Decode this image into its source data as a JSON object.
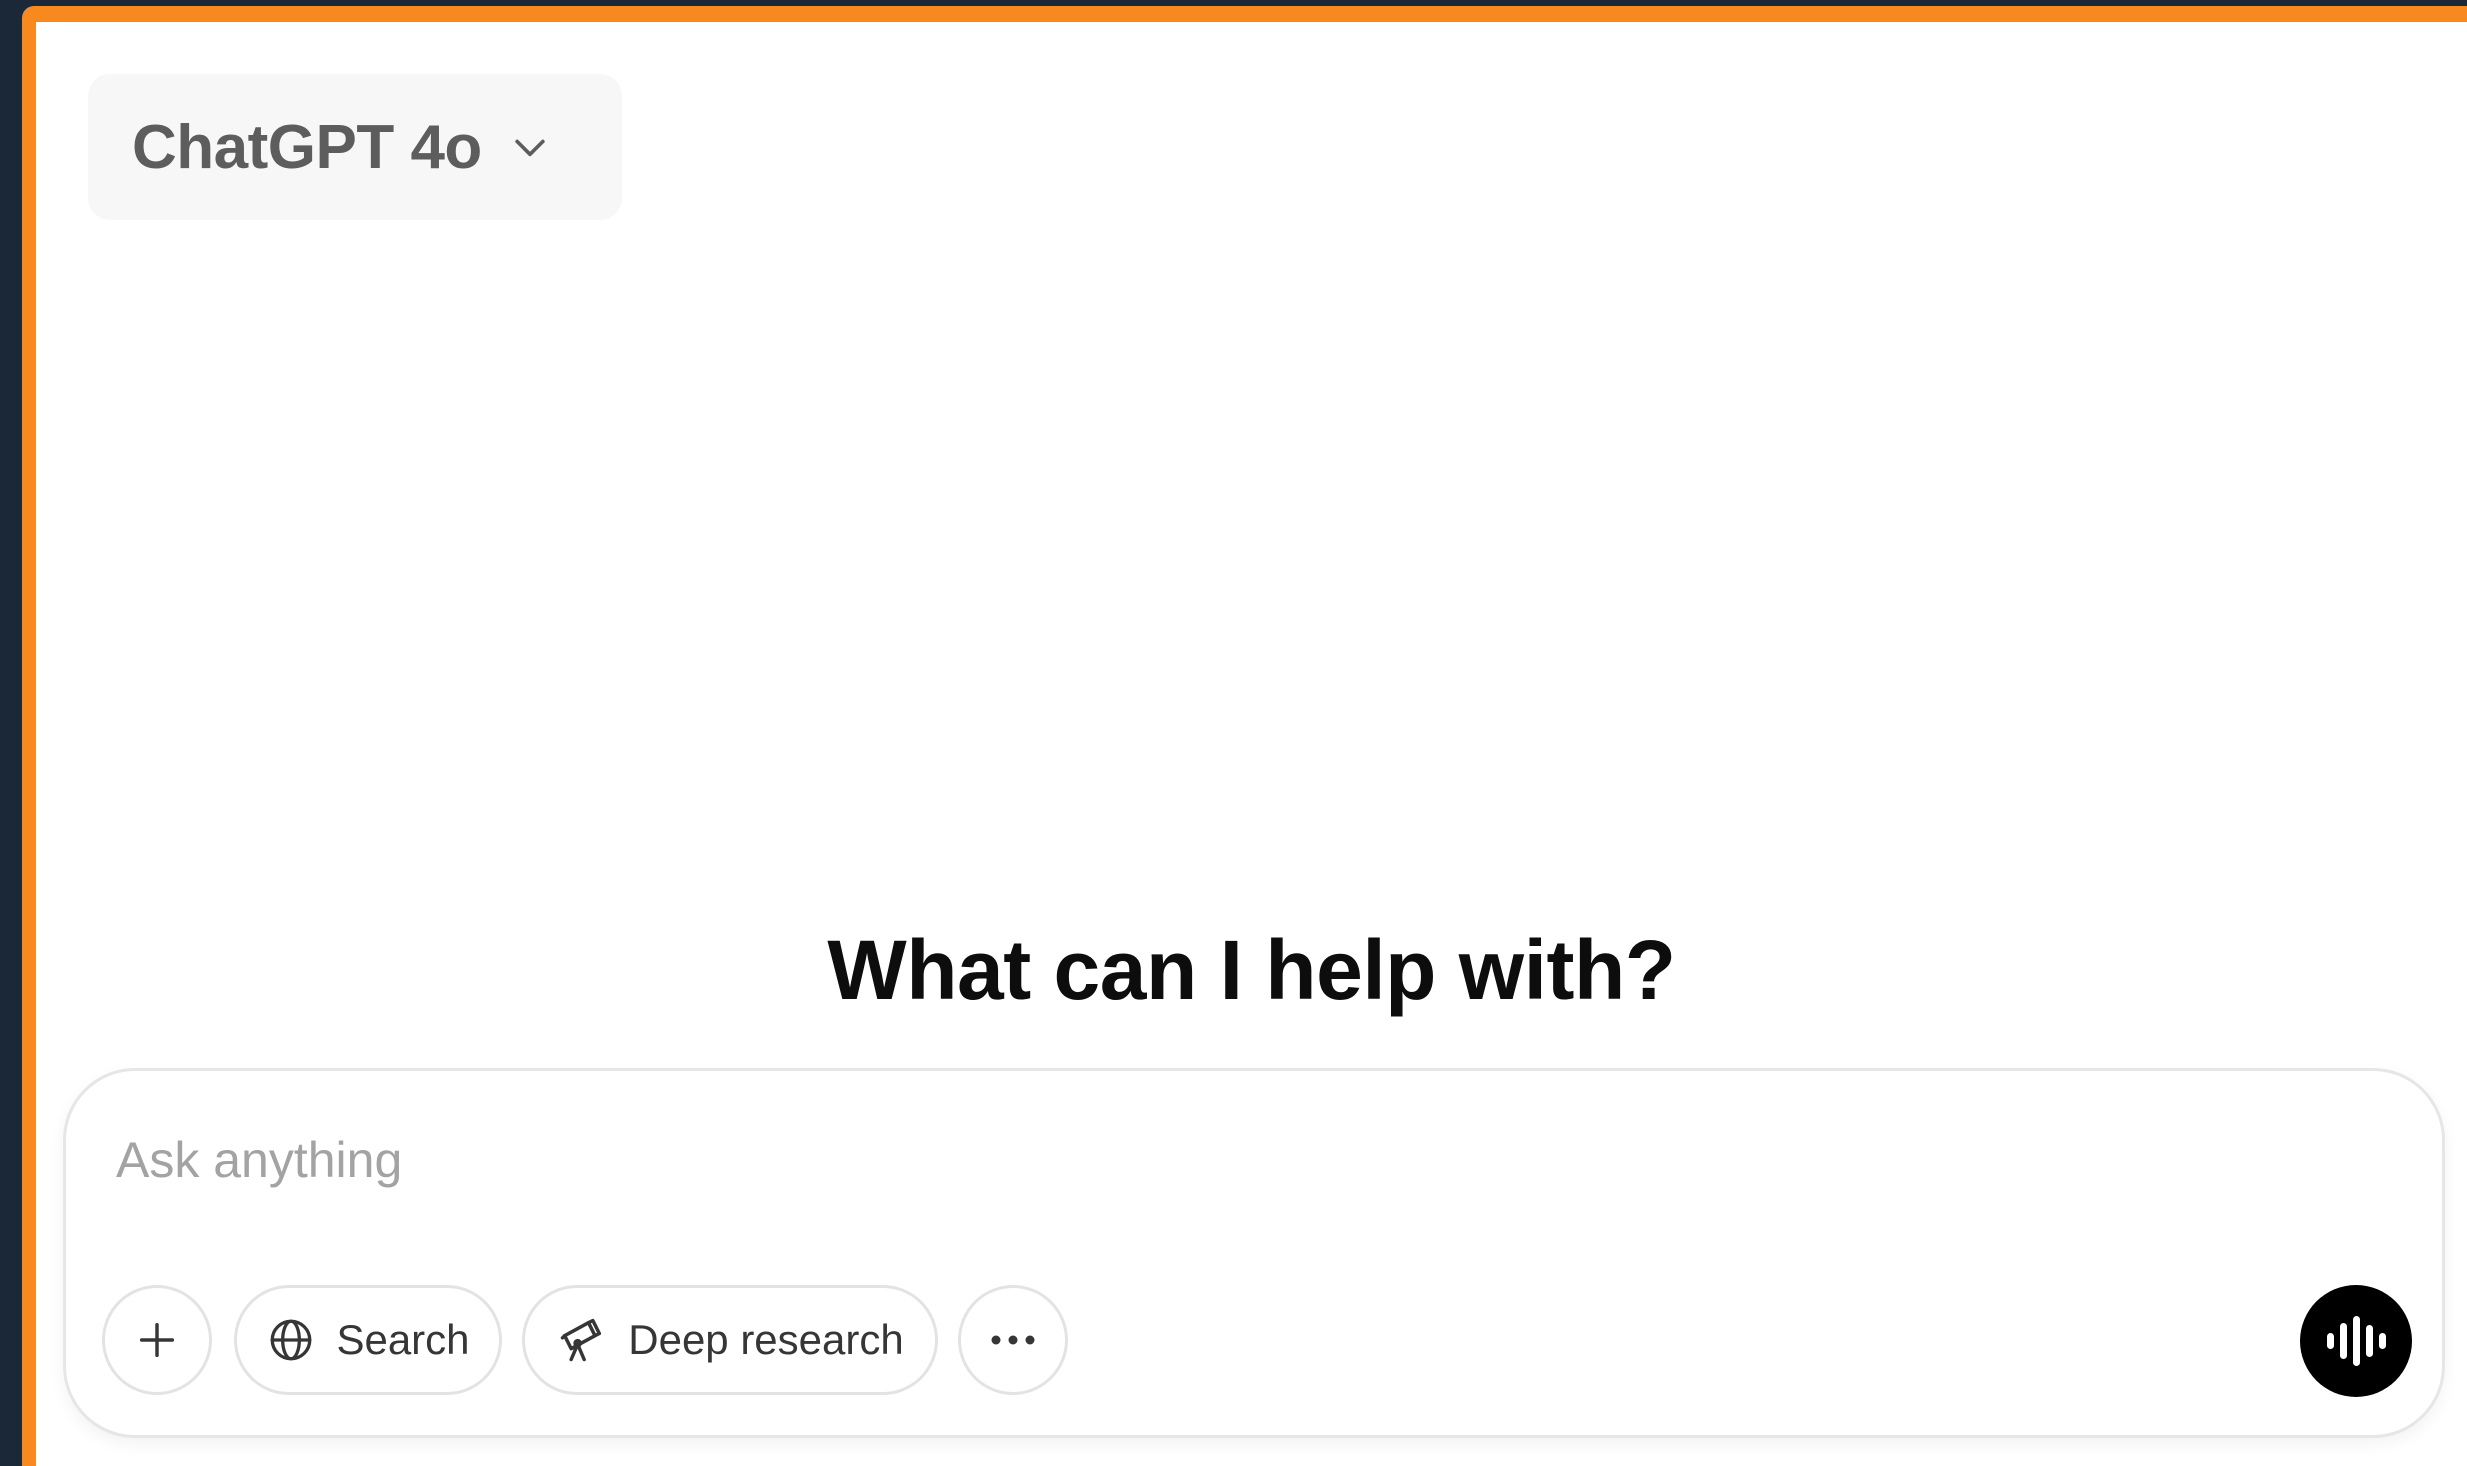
{
  "header": {
    "model_name": "ChatGPT 4o"
  },
  "main": {
    "headline": "What can I help with?"
  },
  "composer": {
    "placeholder": "Ask anything",
    "buttons": {
      "search_label": "Search",
      "deep_research_label": "Deep research"
    },
    "icons": {
      "add": "plus-icon",
      "search": "globe-icon",
      "deep_research": "telescope-icon",
      "more": "ellipsis-icon",
      "voice": "voice-waveform-icon"
    }
  },
  "colors": {
    "accent_border": "#f7891f",
    "background_outer": "#1b2838",
    "model_picker_bg": "#f7f7f7",
    "voice_button_bg": "#000000"
  }
}
